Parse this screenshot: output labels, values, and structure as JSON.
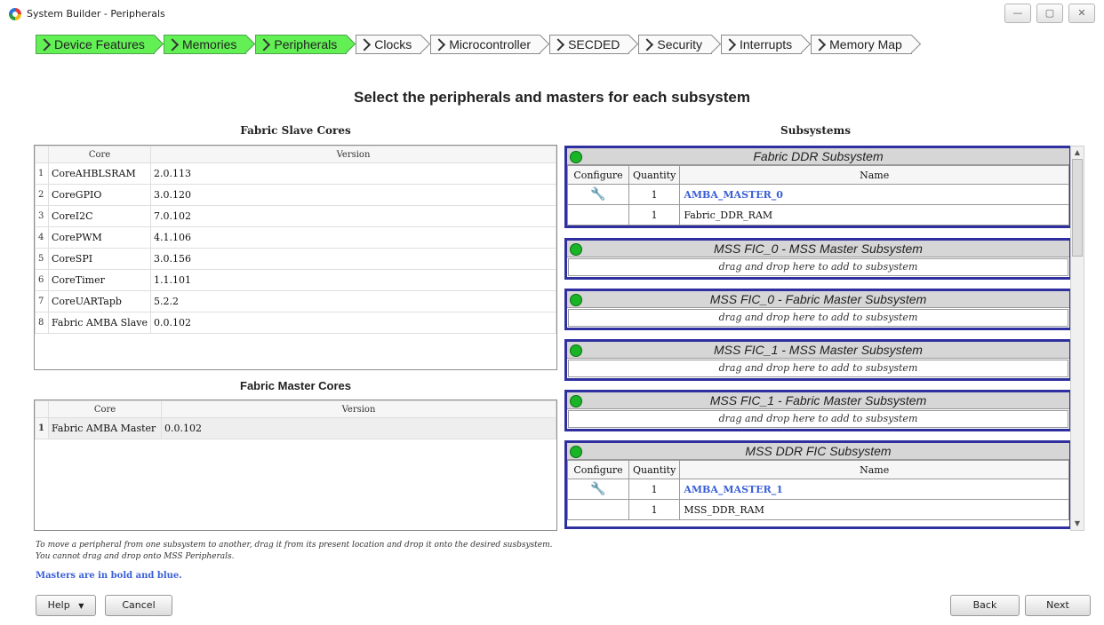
{
  "window": {
    "title": "System Builder - Peripherals",
    "controls": [
      "—",
      "▢",
      "✕"
    ]
  },
  "wizard_steps": [
    {
      "label": "Device Features",
      "done": true
    },
    {
      "label": "Memories",
      "done": true
    },
    {
      "label": "Peripherals",
      "done": true
    },
    {
      "label": "Clocks",
      "done": false
    },
    {
      "label": "Microcontroller",
      "done": false
    },
    {
      "label": "SECDED",
      "done": false
    },
    {
      "label": "Security",
      "done": false
    },
    {
      "label": "Interrupts",
      "done": false
    },
    {
      "label": "Memory Map",
      "done": false
    }
  ],
  "heading": "Select the peripherals and masters for each subsystem",
  "slave_cores": {
    "title": "Fabric Slave Cores",
    "columns": [
      "Core",
      "Version"
    ],
    "rows": [
      [
        "1",
        "CoreAHBLSRAM",
        "2.0.113"
      ],
      [
        "2",
        "CoreGPIO",
        "3.0.120"
      ],
      [
        "3",
        "CoreI2C",
        "7.0.102"
      ],
      [
        "4",
        "CorePWM",
        "4.1.106"
      ],
      [
        "5",
        "CoreSPI",
        "3.0.156"
      ],
      [
        "6",
        "CoreTimer",
        "1.1.101"
      ],
      [
        "7",
        "CoreUARTapb",
        "5.2.2"
      ],
      [
        "8",
        "Fabric AMBA Slave",
        "0.0.102"
      ]
    ]
  },
  "master_cores": {
    "title": "Fabric Master Cores",
    "columns": [
      "Core",
      "Version"
    ],
    "rows": [
      [
        "1",
        "Fabric AMBA Master",
        "0.0.102"
      ]
    ]
  },
  "subsystems": {
    "title": "Subsystems",
    "drop_hint": "drag and drop here to add to subsystem",
    "table_columns": [
      "Configure",
      "Quantity",
      "Name"
    ],
    "items": [
      {
        "name": "Fabric DDR Subsystem",
        "rows": [
          [
            "1",
            "AMBA_MASTER_0"
          ],
          [
            "1",
            "Fabric_DDR_RAM"
          ]
        ]
      },
      {
        "name": "MSS FIC_0 - MSS Master Subsystem",
        "rows": []
      },
      {
        "name": "MSS FIC_0 - Fabric Master Subsystem",
        "rows": []
      },
      {
        "name": "MSS FIC_1 - MSS Master Subsystem",
        "rows": []
      },
      {
        "name": "MSS FIC_1 - Fabric Master Subsystem",
        "rows": []
      },
      {
        "name": "MSS DDR FIC Subsystem",
        "rows": [
          [
            "1",
            "AMBA_MASTER_1"
          ],
          [
            "1",
            "MSS_DDR_RAM"
          ]
        ]
      }
    ]
  },
  "notes": {
    "line1": "To move a peripheral from one subsystem to another, drag it from its present location and drop it onto the desired susbsystem.",
    "line2": "You cannot drag and drop onto MSS Peripherals.",
    "masters": "Masters are in bold and blue."
  },
  "buttons": {
    "help": "Help",
    "help_arrow": "▼",
    "cancel": "Cancel",
    "back": "Back",
    "next": "Next"
  },
  "icons": {
    "wrench": "wrench-icon",
    "scroll_up": "▲",
    "scroll_down": "▼"
  }
}
